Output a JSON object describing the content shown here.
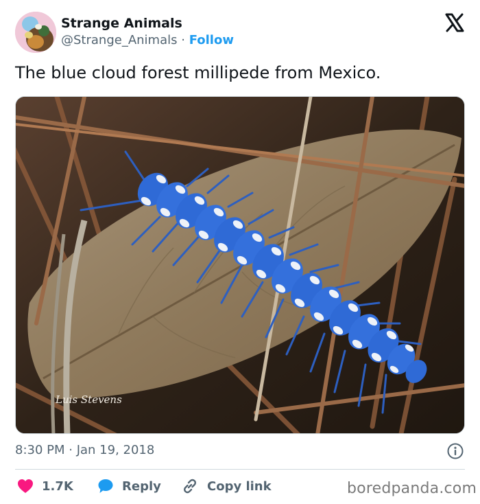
{
  "account": {
    "display_name": "Strange Animals",
    "handle": "@Strange_Animals",
    "separator": "·",
    "follow_label": "Follow"
  },
  "tweet": {
    "text": "The blue cloud forest millipede from Mexico.",
    "timestamp": "8:30 PM · Jan 19, 2018",
    "photo_credit": "Luis Stevens"
  },
  "actions": {
    "like_count": "1.7K",
    "reply_label": "Reply",
    "copy_link_label": "Copy link"
  },
  "watermark": "boredpanda.com",
  "icons": {
    "platform": "x-logo-icon",
    "like": "heart-icon",
    "reply": "speech-bubble-icon",
    "copy": "link-icon",
    "info": "info-icon"
  },
  "colors": {
    "follow": "#1d9bf0",
    "like": "#f91880",
    "reply": "#1d9bf0",
    "secondary_text": "#536471"
  }
}
